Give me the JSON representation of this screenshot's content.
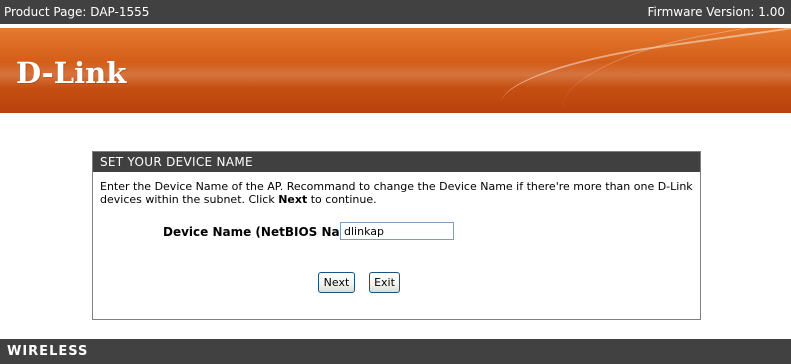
{
  "topbar": {
    "product_page": "Product Page: DAP-1555",
    "firmware": "Firmware Version: 1.00"
  },
  "banner": {
    "logo": "D-Link",
    "logo_icon": "dlink-logo"
  },
  "panel": {
    "title": "SET YOUR DEVICE NAME",
    "desc_before": "Enter the Device Name of the AP. Recommand to change the Device Name if there're more than one D-Link devices within the subnet. Click ",
    "desc_bold": "Next",
    "desc_after": " to continue.",
    "device_name_label": "Device Name (NetBIOS Name)",
    "device_name_value": "dlinkap",
    "next_label": "Next",
    "exit_label": "Exit"
  },
  "footer": {
    "brand": "WIRELESS"
  },
  "colors": {
    "bar": "#414141",
    "banner_orange": "#d15a16",
    "panel_header": "#404040"
  }
}
